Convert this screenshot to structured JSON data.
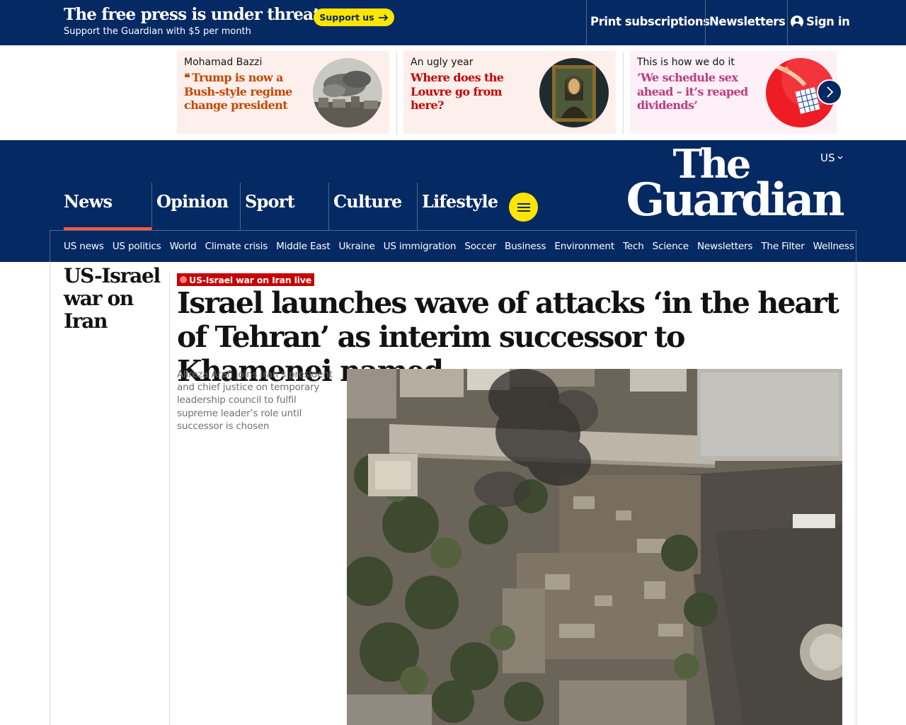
{
  "promo_banner": {
    "title": "The free press is under threat",
    "subtitle": "Support the Guardian with $5 per month",
    "support_label": "Support us"
  },
  "top_links": {
    "print": "Print subscriptions",
    "newsletters": "Newsletters",
    "signin": "Sign in"
  },
  "highlights": [
    {
      "kicker": "Mohamad Bazzi",
      "headline": "Trump is now a Bush-style regime change president",
      "is_opinion": true
    },
    {
      "kicker": "An ugly year",
      "headline": "Where does the Louvre go from here?"
    },
    {
      "kicker": "This is how we do it",
      "headline": "‘We schedule sex ahead – it’s reaped dividends’"
    }
  ],
  "edition": "US",
  "logo": {
    "line1": "The",
    "line2": "Guardian"
  },
  "pillars": [
    "News",
    "Opinion",
    "Sport",
    "Culture",
    "Lifestyle"
  ],
  "active_pillar": "News",
  "subnav": [
    "US news",
    "US politics",
    "World",
    "Climate crisis",
    "Middle East",
    "Ukraine",
    "US immigration",
    "Soccer",
    "Business",
    "Environment",
    "Tech",
    "Science",
    "Newsletters",
    "The Filter",
    "Wellness"
  ],
  "article": {
    "series": "US-Israel war on Iran",
    "live_label": "US-Israel war on Iran live",
    "headline": "Israel launches wave of attacks ‘in the heart of Tehran’ as interim successor to Khamenei named",
    "standfirst": "Alireza Arafi joins Iran’s president and chief justice on temporary leadership council to fulfil supreme leader’s role until successor is chosen"
  },
  "colors": {
    "brand_blue": "#052962",
    "support_yellow": "#ffe500",
    "news_red": "#c70000",
    "opinion_orange": "#c74600",
    "lifestyle_pink": "#bb3b80",
    "news_underline": "#ff5943"
  }
}
